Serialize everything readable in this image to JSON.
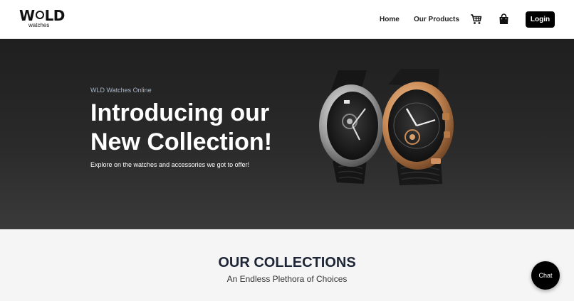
{
  "brand": {
    "logo_left": "W",
    "logo_right": "LD",
    "logo_sub": "watches"
  },
  "nav": {
    "home": "Home",
    "products": "Our Products",
    "cart_icon": "cart-icon",
    "bag_icon": "shopping-bag-icon",
    "login": "Login"
  },
  "hero": {
    "kicker": "WLD Watches Online",
    "title_line1": "Introducing our",
    "title_line2": "New Collection!",
    "subtitle": "Explore on the watches and accessories we got to offer!"
  },
  "collections": {
    "title": "OUR COLLECTIONS",
    "subtitle": "An Endless Plethora of Choices"
  },
  "chat": {
    "label": "Chat"
  },
  "colors": {
    "hero_bg": "#2a2a2a",
    "kicker": "#a8b4c4",
    "collections_bg": "#f5f5f5",
    "title_text": "#1e2535"
  }
}
